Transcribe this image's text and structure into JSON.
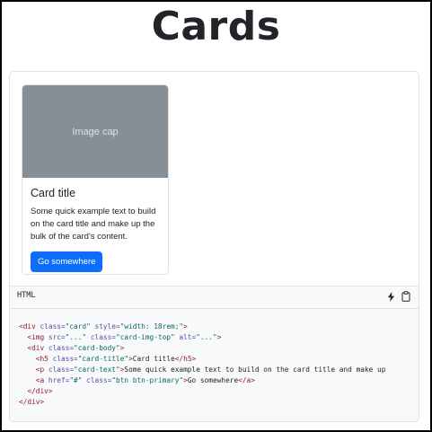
{
  "page": {
    "title": "Cards"
  },
  "card": {
    "image_cap": "Image cap",
    "title": "Card title",
    "text": "Some quick example text to build on the card title and make up the bulk of the card's content.",
    "button_label": "Go somewhere"
  },
  "code_header": {
    "language": "HTML",
    "icons": [
      "lightning-icon",
      "clipboard-icon"
    ]
  },
  "code": {
    "lines": [
      [
        {
          "c": "tag",
          "t": "<div "
        },
        {
          "c": "attr",
          "t": "class="
        },
        {
          "c": "str",
          "t": "\"card\""
        },
        {
          "c": "attr",
          "t": " style="
        },
        {
          "c": "str",
          "t": "\"width: 18rem;\""
        },
        {
          "c": "tag",
          "t": ">"
        }
      ],
      [
        {
          "c": "txt",
          "t": "  "
        },
        {
          "c": "tag",
          "t": "<img "
        },
        {
          "c": "attr",
          "t": "src="
        },
        {
          "c": "str",
          "t": "\"...\""
        },
        {
          "c": "attr",
          "t": " class="
        },
        {
          "c": "str",
          "t": "\"card-img-top\""
        },
        {
          "c": "attr",
          "t": " alt="
        },
        {
          "c": "str",
          "t": "\"...\""
        },
        {
          "c": "tag",
          "t": ">"
        }
      ],
      [
        {
          "c": "txt",
          "t": "  "
        },
        {
          "c": "tag",
          "t": "<div "
        },
        {
          "c": "attr",
          "t": "class="
        },
        {
          "c": "str",
          "t": "\"card-body\""
        },
        {
          "c": "tag",
          "t": ">"
        }
      ],
      [
        {
          "c": "txt",
          "t": "    "
        },
        {
          "c": "tag",
          "t": "<h5 "
        },
        {
          "c": "attr",
          "t": "class="
        },
        {
          "c": "str",
          "t": "\"card-title\""
        },
        {
          "c": "tag",
          "t": ">"
        },
        {
          "c": "txt",
          "t": "Card title"
        },
        {
          "c": "tag",
          "t": "</h5>"
        }
      ],
      [
        {
          "c": "txt",
          "t": "    "
        },
        {
          "c": "tag",
          "t": "<p "
        },
        {
          "c": "attr",
          "t": "class="
        },
        {
          "c": "str",
          "t": "\"card-text\""
        },
        {
          "c": "tag",
          "t": ">"
        },
        {
          "c": "txt",
          "t": "Some quick example text to build on the card title and make up"
        }
      ],
      [
        {
          "c": "txt",
          "t": "    "
        },
        {
          "c": "tag",
          "t": "<a "
        },
        {
          "c": "attr",
          "t": "href="
        },
        {
          "c": "str",
          "t": "\"#\""
        },
        {
          "c": "attr",
          "t": " class="
        },
        {
          "c": "str",
          "t": "\"btn btn-primary\""
        },
        {
          "c": "tag",
          "t": ">"
        },
        {
          "c": "txt",
          "t": "Go somewhere"
        },
        {
          "c": "tag",
          "t": "</a>"
        }
      ],
      [
        {
          "c": "txt",
          "t": "  "
        },
        {
          "c": "tag",
          "t": "</div>"
        }
      ],
      [
        {
          "c": "tag",
          "t": "</div>"
        }
      ]
    ]
  },
  "colors": {
    "primary": "#0d6efd",
    "image_placeholder": "#868e96",
    "code_background": "#f8f9fa",
    "border": "#dee2e6"
  }
}
